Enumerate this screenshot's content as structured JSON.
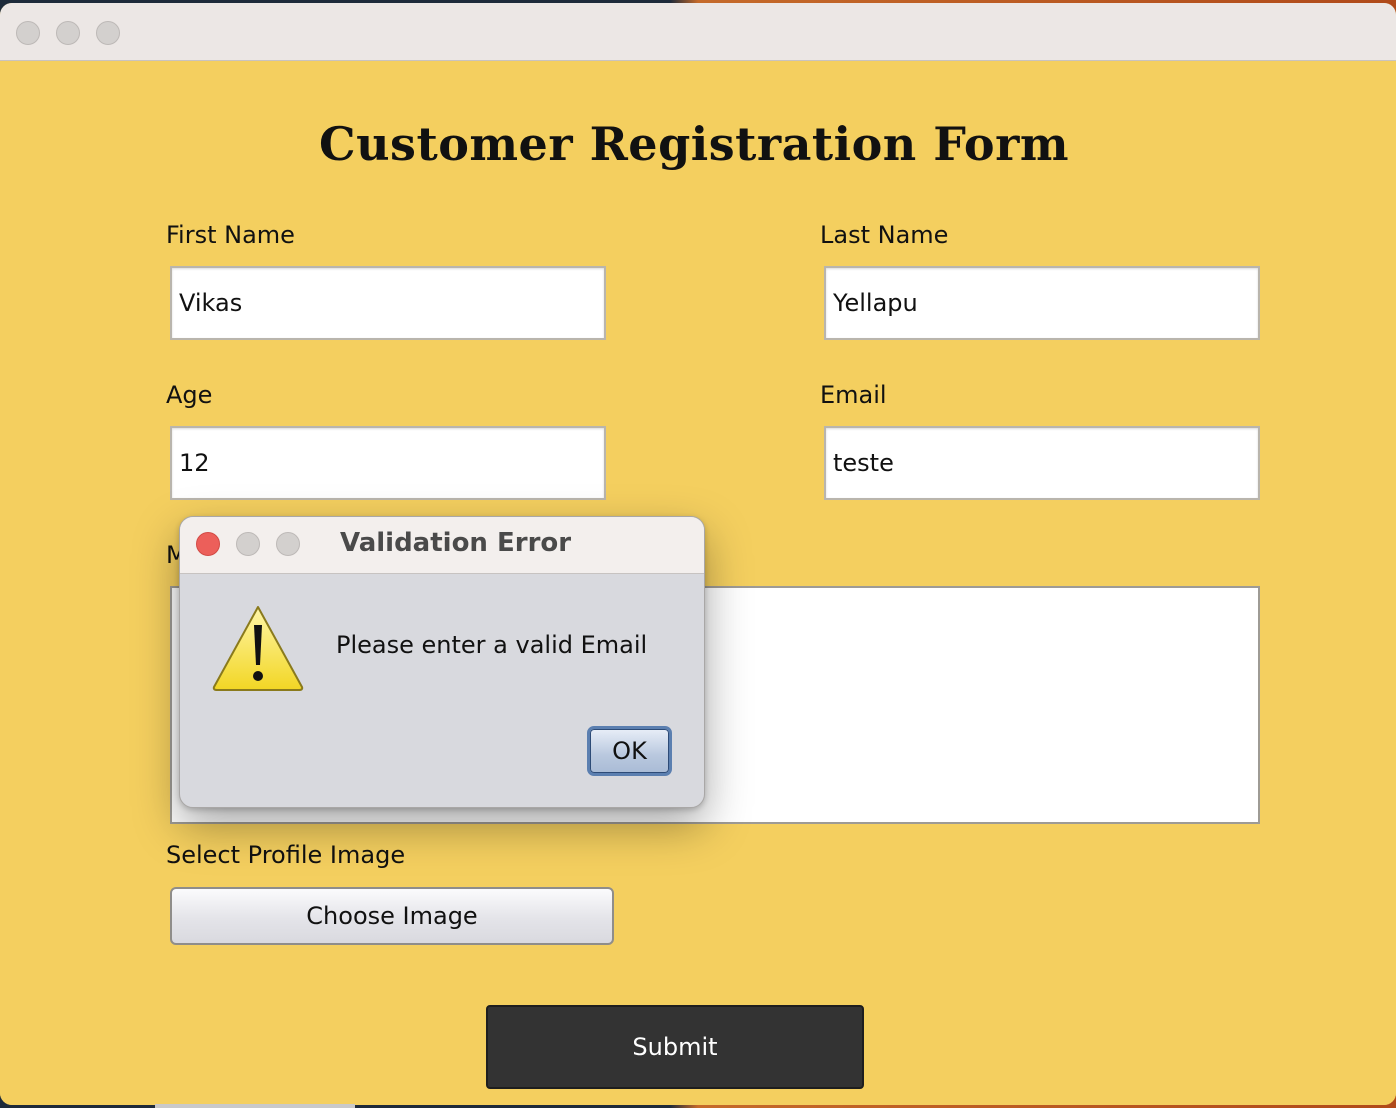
{
  "window": {
    "title": ""
  },
  "form": {
    "title": "Customer Registration Form",
    "first_name": {
      "label": "First Name",
      "value": "Vikas"
    },
    "last_name": {
      "label": "Last Name",
      "value": "Yellapu"
    },
    "age": {
      "label": "Age",
      "value": "12"
    },
    "email": {
      "label": "Email",
      "value": "teste"
    },
    "message": {
      "label_partial": "M",
      "value": ""
    },
    "profile_image": {
      "label": "Select Profile Image",
      "button_label": "Choose Image"
    },
    "submit_label": "Submit"
  },
  "dialog": {
    "title": "Validation Error",
    "message": "Please enter a valid Email",
    "ok_label": "OK",
    "icon": "warning-icon"
  },
  "colors": {
    "form_background": "#f4cf5f",
    "submit_background": "#333333",
    "dialog_close": "#ec5f5a"
  }
}
